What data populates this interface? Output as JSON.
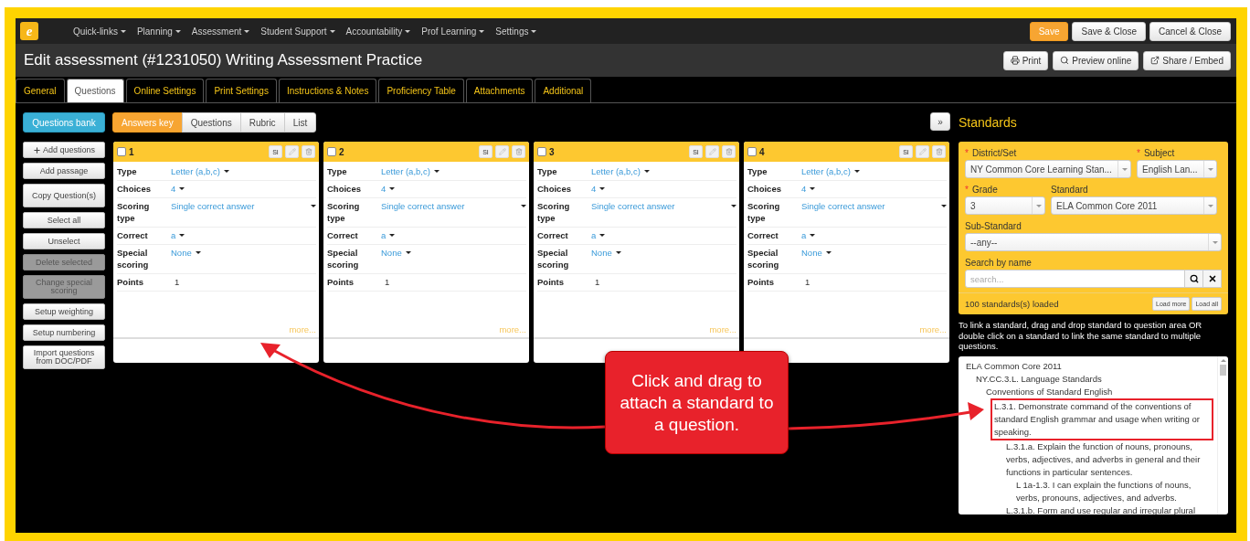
{
  "nav": {
    "logo": "e",
    "items": [
      "Quick-links",
      "Planning",
      "Assessment",
      "Student Support",
      "Accountability",
      "Prof Learning",
      "Settings"
    ],
    "buttons": [
      {
        "label": "Save",
        "kind": "primary"
      },
      {
        "label": "Save & Close",
        "kind": "default"
      },
      {
        "label": "Cancel & Close",
        "kind": "default"
      }
    ]
  },
  "title": "Edit assessment (#1231050) Writing Assessment Practice",
  "header_buttons": [
    {
      "label": "Print"
    },
    {
      "label": "Preview online"
    },
    {
      "label": "Share / Embed"
    }
  ],
  "tabs": [
    {
      "label": "General",
      "selected": false
    },
    {
      "label": "Questions",
      "selected": true
    },
    {
      "label": "Online Settings",
      "selected": false
    },
    {
      "label": "Print Settings",
      "selected": false
    },
    {
      "label": "Instructions & Notes",
      "selected": false
    },
    {
      "label": "Proficiency Table",
      "selected": false
    },
    {
      "label": "Attachments",
      "selected": false
    },
    {
      "label": "Additional",
      "selected": false
    }
  ],
  "questions_bank": "Questions bank",
  "sidebar_buttons": [
    {
      "label": "Add questions",
      "kind": "add",
      "disabled": false
    },
    {
      "label": "Add passage",
      "disabled": false
    },
    {
      "label": "Copy Question(s)",
      "disabled": false
    },
    {
      "label": "Select all",
      "disabled": false
    },
    {
      "label": "Unselect",
      "disabled": false
    },
    {
      "label": "Delete selected",
      "disabled": true
    },
    {
      "label": "Change special scoring",
      "disabled": true
    },
    {
      "label": "Setup weighting",
      "disabled": false
    },
    {
      "label": "Setup numbering",
      "disabled": false
    },
    {
      "label": "Import questions from DOC/PDF",
      "disabled": false
    }
  ],
  "view_toggle": [
    {
      "label": "Answers key",
      "selected": true
    },
    {
      "label": "Questions",
      "selected": false
    },
    {
      "label": "Rubric",
      "selected": false
    },
    {
      "label": "List",
      "selected": false
    }
  ],
  "expand_button": "»",
  "cards": [
    {
      "number": "1",
      "checked": false,
      "si": "SI",
      "more": "more...",
      "rows": [
        {
          "label": "Type",
          "value": "Letter (a,b,c)",
          "kind": "select"
        },
        {
          "label": "Choices",
          "value": "4",
          "kind": "select"
        },
        {
          "label": "Scoring type",
          "value": "Single correct answer",
          "kind": "wide-select"
        },
        {
          "label": "Correct",
          "value": "a",
          "kind": "select"
        },
        {
          "label": "Special scoring",
          "value": "None",
          "kind": "select"
        },
        {
          "label": "Points",
          "value": "1",
          "kind": "plain"
        }
      ]
    },
    {
      "number": "2",
      "checked": false,
      "si": "SI",
      "more": "more...",
      "rows": [
        {
          "label": "Type",
          "value": "Letter (a,b,c)",
          "kind": "select"
        },
        {
          "label": "Choices",
          "value": "4",
          "kind": "select"
        },
        {
          "label": "Scoring type",
          "value": "Single correct answer",
          "kind": "wide-select"
        },
        {
          "label": "Correct",
          "value": "a",
          "kind": "select"
        },
        {
          "label": "Special scoring",
          "value": "None",
          "kind": "select"
        },
        {
          "label": "Points",
          "value": "1",
          "kind": "plain"
        }
      ]
    },
    {
      "number": "3",
      "checked": false,
      "si": "SI",
      "more": "more...",
      "rows": [
        {
          "label": "Type",
          "value": "Letter (a,b,c)",
          "kind": "select"
        },
        {
          "label": "Choices",
          "value": "4",
          "kind": "select"
        },
        {
          "label": "Scoring type",
          "value": "Single correct answer",
          "kind": "wide-select"
        },
        {
          "label": "Correct",
          "value": "a",
          "kind": "select"
        },
        {
          "label": "Special scoring",
          "value": "None",
          "kind": "select"
        },
        {
          "label": "Points",
          "value": "1",
          "kind": "plain"
        }
      ]
    },
    {
      "number": "4",
      "checked": false,
      "si": "SI",
      "more": "more...",
      "rows": [
        {
          "label": "Type",
          "value": "Letter (a,b,c)",
          "kind": "select"
        },
        {
          "label": "Choices",
          "value": "4",
          "kind": "select"
        },
        {
          "label": "Scoring type",
          "value": "Single correct answer",
          "kind": "wide-select"
        },
        {
          "label": "Correct",
          "value": "a",
          "kind": "select"
        },
        {
          "label": "Special scoring",
          "value": "None",
          "kind": "select"
        },
        {
          "label": "Points",
          "value": "1",
          "kind": "plain"
        }
      ]
    }
  ],
  "standards": {
    "title": "Standards",
    "district": {
      "label": "District/Set",
      "required_mark": "*",
      "value": "NY Common Core Learning Stan..."
    },
    "subject": {
      "label": "Subject",
      "required_mark": "*",
      "value": "English Lan..."
    },
    "grade": {
      "label": "Grade",
      "required_mark": "*",
      "value": "3"
    },
    "standard": {
      "label": "Standard",
      "value": "ELA Common Core 2011"
    },
    "sub_standard": {
      "label": "Sub-Standard",
      "value": "--any--"
    },
    "search": {
      "label": "Search by name",
      "placeholder": "search..."
    },
    "count": "100 standards(s) loaded",
    "load_buttons": [
      "Load more",
      "Load all"
    ],
    "instructions": "To link a standard, drag and drop standard to question area OR double click on a standard to link the same standard to multiple questions.",
    "tree": [
      {
        "text": "ELA Common Core 2011",
        "highlighted": false,
        "children": [
          {
            "text": "NY.CC.3.L. Language Standards",
            "highlighted": false,
            "children": [
              {
                "text": "Conventions of Standard English",
                "highlighted": false,
                "children": [
                  {
                    "text": "L.3.1. Demonstrate command of the conventions of standard English grammar and usage when writing or speaking.",
                    "highlighted": true,
                    "children": [
                      {
                        "text": "L.3.1.a. Explain the function of nouns, pronouns, verbs, adjectives, and adverbs in general and their functions in particular sentences.",
                        "highlighted": false,
                        "children": [
                          {
                            "text": "L 1a-1.3. I can explain the functions of nouns, verbs, pronouns, adjectives, and adverbs.",
                            "highlighted": false
                          }
                        ]
                      },
                      {
                        "text": "L.3.1.b. Form and use regular and irregular plural",
                        "highlighted": false
                      }
                    ]
                  }
                ]
              }
            ]
          }
        ]
      }
    ]
  },
  "callout": "Click and drag to attach a standard to a question."
}
